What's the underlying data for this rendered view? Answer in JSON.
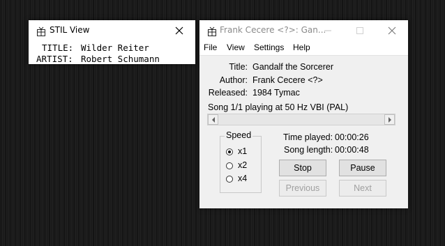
{
  "stil": {
    "title": "STIL View",
    "title_label": "TITLE:",
    "title_value": "Wilder Reiter",
    "artist_label": "ARTIST:",
    "artist_value": "Robert Schumann"
  },
  "player": {
    "title": "Frank Cecere <?>: Gan...",
    "menu": [
      "File",
      "View",
      "Settings",
      "Help"
    ],
    "info": {
      "title_label": "Title:",
      "title_value": "Gandalf the Sorcerer",
      "author_label": "Author:",
      "author_value": "Frank Cecere <?>",
      "released_label": "Released:",
      "released_value": "1984 Tymac"
    },
    "status": "Song 1/1 playing at 50 Hz VBI (PAL)",
    "speed": {
      "label": "Speed",
      "options": [
        "x1",
        "x2",
        "x4"
      ],
      "selected": "x1"
    },
    "time_played_label": "Time played:",
    "time_played_value": "00:00:26",
    "song_length_label": "Song length:",
    "song_length_value": "00:00:48",
    "buttons": {
      "stop": "Stop",
      "pause": "Pause",
      "previous": "Previous",
      "next": "Next"
    }
  }
}
